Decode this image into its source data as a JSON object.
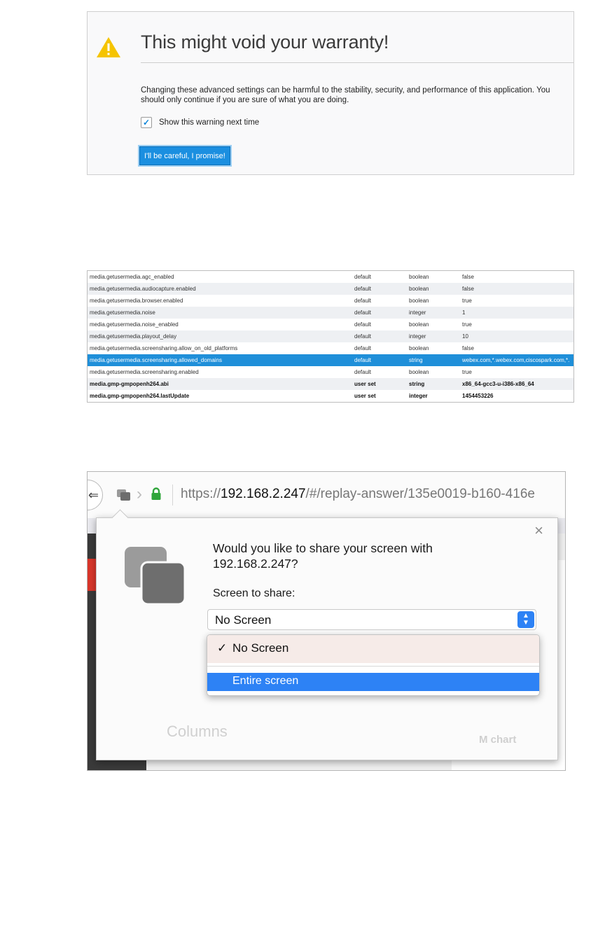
{
  "warning": {
    "title": "This might void your warranty!",
    "body": "Changing these advanced settings can be harmful to the stability, security, and performance of this application. You should only continue if you are sure of what you are doing.",
    "checkbox_label": "Show this warning next time",
    "checkbox_checked": true,
    "button_label": "I'll be careful, I promise!"
  },
  "prefs": {
    "rows": [
      {
        "name": "media.getusermedia.agc_enabled",
        "status": "default",
        "type": "boolean",
        "value": "false"
      },
      {
        "name": "media.getusermedia.audiocapture.enabled",
        "status": "default",
        "type": "boolean",
        "value": "false"
      },
      {
        "name": "media.getusermedia.browser.enabled",
        "status": "default",
        "type": "boolean",
        "value": "true"
      },
      {
        "name": "media.getusermedia.noise",
        "status": "default",
        "type": "integer",
        "value": "1"
      },
      {
        "name": "media.getusermedia.noise_enabled",
        "status": "default",
        "type": "boolean",
        "value": "true"
      },
      {
        "name": "media.getusermedia.playout_delay",
        "status": "default",
        "type": "integer",
        "value": "10"
      },
      {
        "name": "media.getusermedia.screensharing.allow_on_old_platforms",
        "status": "default",
        "type": "boolean",
        "value": "false"
      },
      {
        "name": "media.getusermedia.screensharing.allowed_domains",
        "status": "default",
        "type": "string",
        "value": "webex.com,*.webex.com,ciscospark.com,*."
      },
      {
        "name": "media.getusermedia.screensharing.enabled",
        "status": "default",
        "type": "boolean",
        "value": "true"
      },
      {
        "name": "media.gmp-gmpopenh264.abi",
        "status": "user set",
        "type": "string",
        "value": "x86_64-gcc3-u-i386-x86_64"
      },
      {
        "name": "media.gmp-gmpopenh264.lastUpdate",
        "status": "user set",
        "type": "integer",
        "value": "1454453226"
      }
    ]
  },
  "share": {
    "url_scheme": "https://",
    "url_host": "192.168.2.247",
    "url_path": "/#/replay-answer/135e0019-b160-416e",
    "question": "Would you like to share your screen with 192.168.2.247?",
    "label": "Screen to share:",
    "selected": "No Screen",
    "options": [
      "No Screen",
      "Entire screen"
    ],
    "close_glyph": "×",
    "bg_columns": "Columns",
    "bg_chart": "M chart"
  },
  "colors": {
    "accent": "#1b8fe0",
    "selected_row": "#1f8fd9",
    "menu_highlight": "#2d82f5",
    "warning_yellow": "#f5c400",
    "lock_green": "#2fa53a"
  }
}
